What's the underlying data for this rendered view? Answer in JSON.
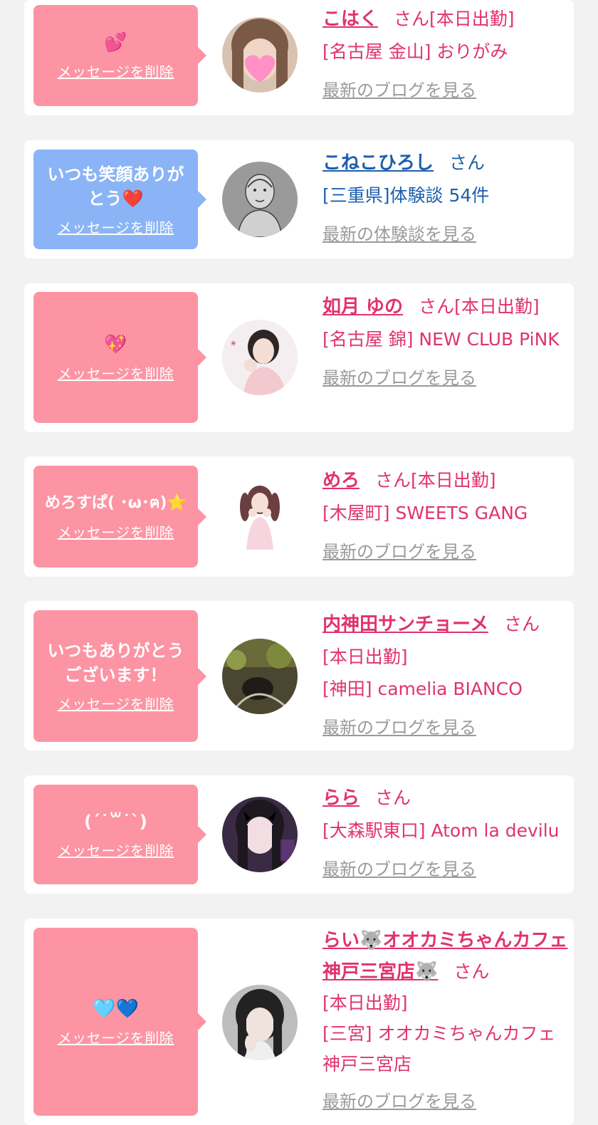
{
  "delete_label": "メッセージを削除",
  "san_label": "さん",
  "cards": [
    {
      "message": "💕",
      "name": "こはく",
      "status": "[本日出勤]",
      "shop": "[名古屋 金山] おりがみ",
      "link": "最新のブログを見る"
    },
    {
      "message": "いつも笑顔ありがとう❤️",
      "name": "こねこひろし",
      "status": "",
      "shop": "[三重県]体験談 54件",
      "link": "最新の体験談を見る"
    },
    {
      "message": "💖",
      "name": "如月 ゆの",
      "status": "[本日出勤]",
      "shop": "[名古屋 錦] NEW CLUB PiNK",
      "link": "最新のブログを見る"
    },
    {
      "message": "めろすぱ( ･ω･ฅ)⭐️",
      "name": "めろ",
      "status": "[本日出勤]",
      "shop": "[木屋町] SWEETS GANG",
      "link": "最新のブログを見る"
    },
    {
      "message": "いつもありがとうございます！",
      "name": "内神田サンチョーメ",
      "status": "[本日出勤]",
      "shop": "[神田] camelia BIANCO",
      "link": "最新のブログを見る"
    },
    {
      "message": "(ˊ˙꒳˙ˋ)",
      "name": "らら",
      "status": "",
      "shop": "[大森駅東口] Atom la devilu",
      "link": "最新のブログを見る"
    },
    {
      "message": "🩵💙",
      "name": "らい🐺オオカミちゃんカフェ神戸三宮店🐺",
      "status": "[本日出勤]",
      "shop": "[三宮] オオカミちゃんカフェ神戸三宮店",
      "link": "最新のブログを見る"
    }
  ],
  "colors": {
    "pink_bubble": "#fc94a3",
    "blue_bubble": "#8ab4f6",
    "name_pink": "#e0336b",
    "name_blue": "#1d5fae",
    "link_gray": "#9a9a9a"
  }
}
